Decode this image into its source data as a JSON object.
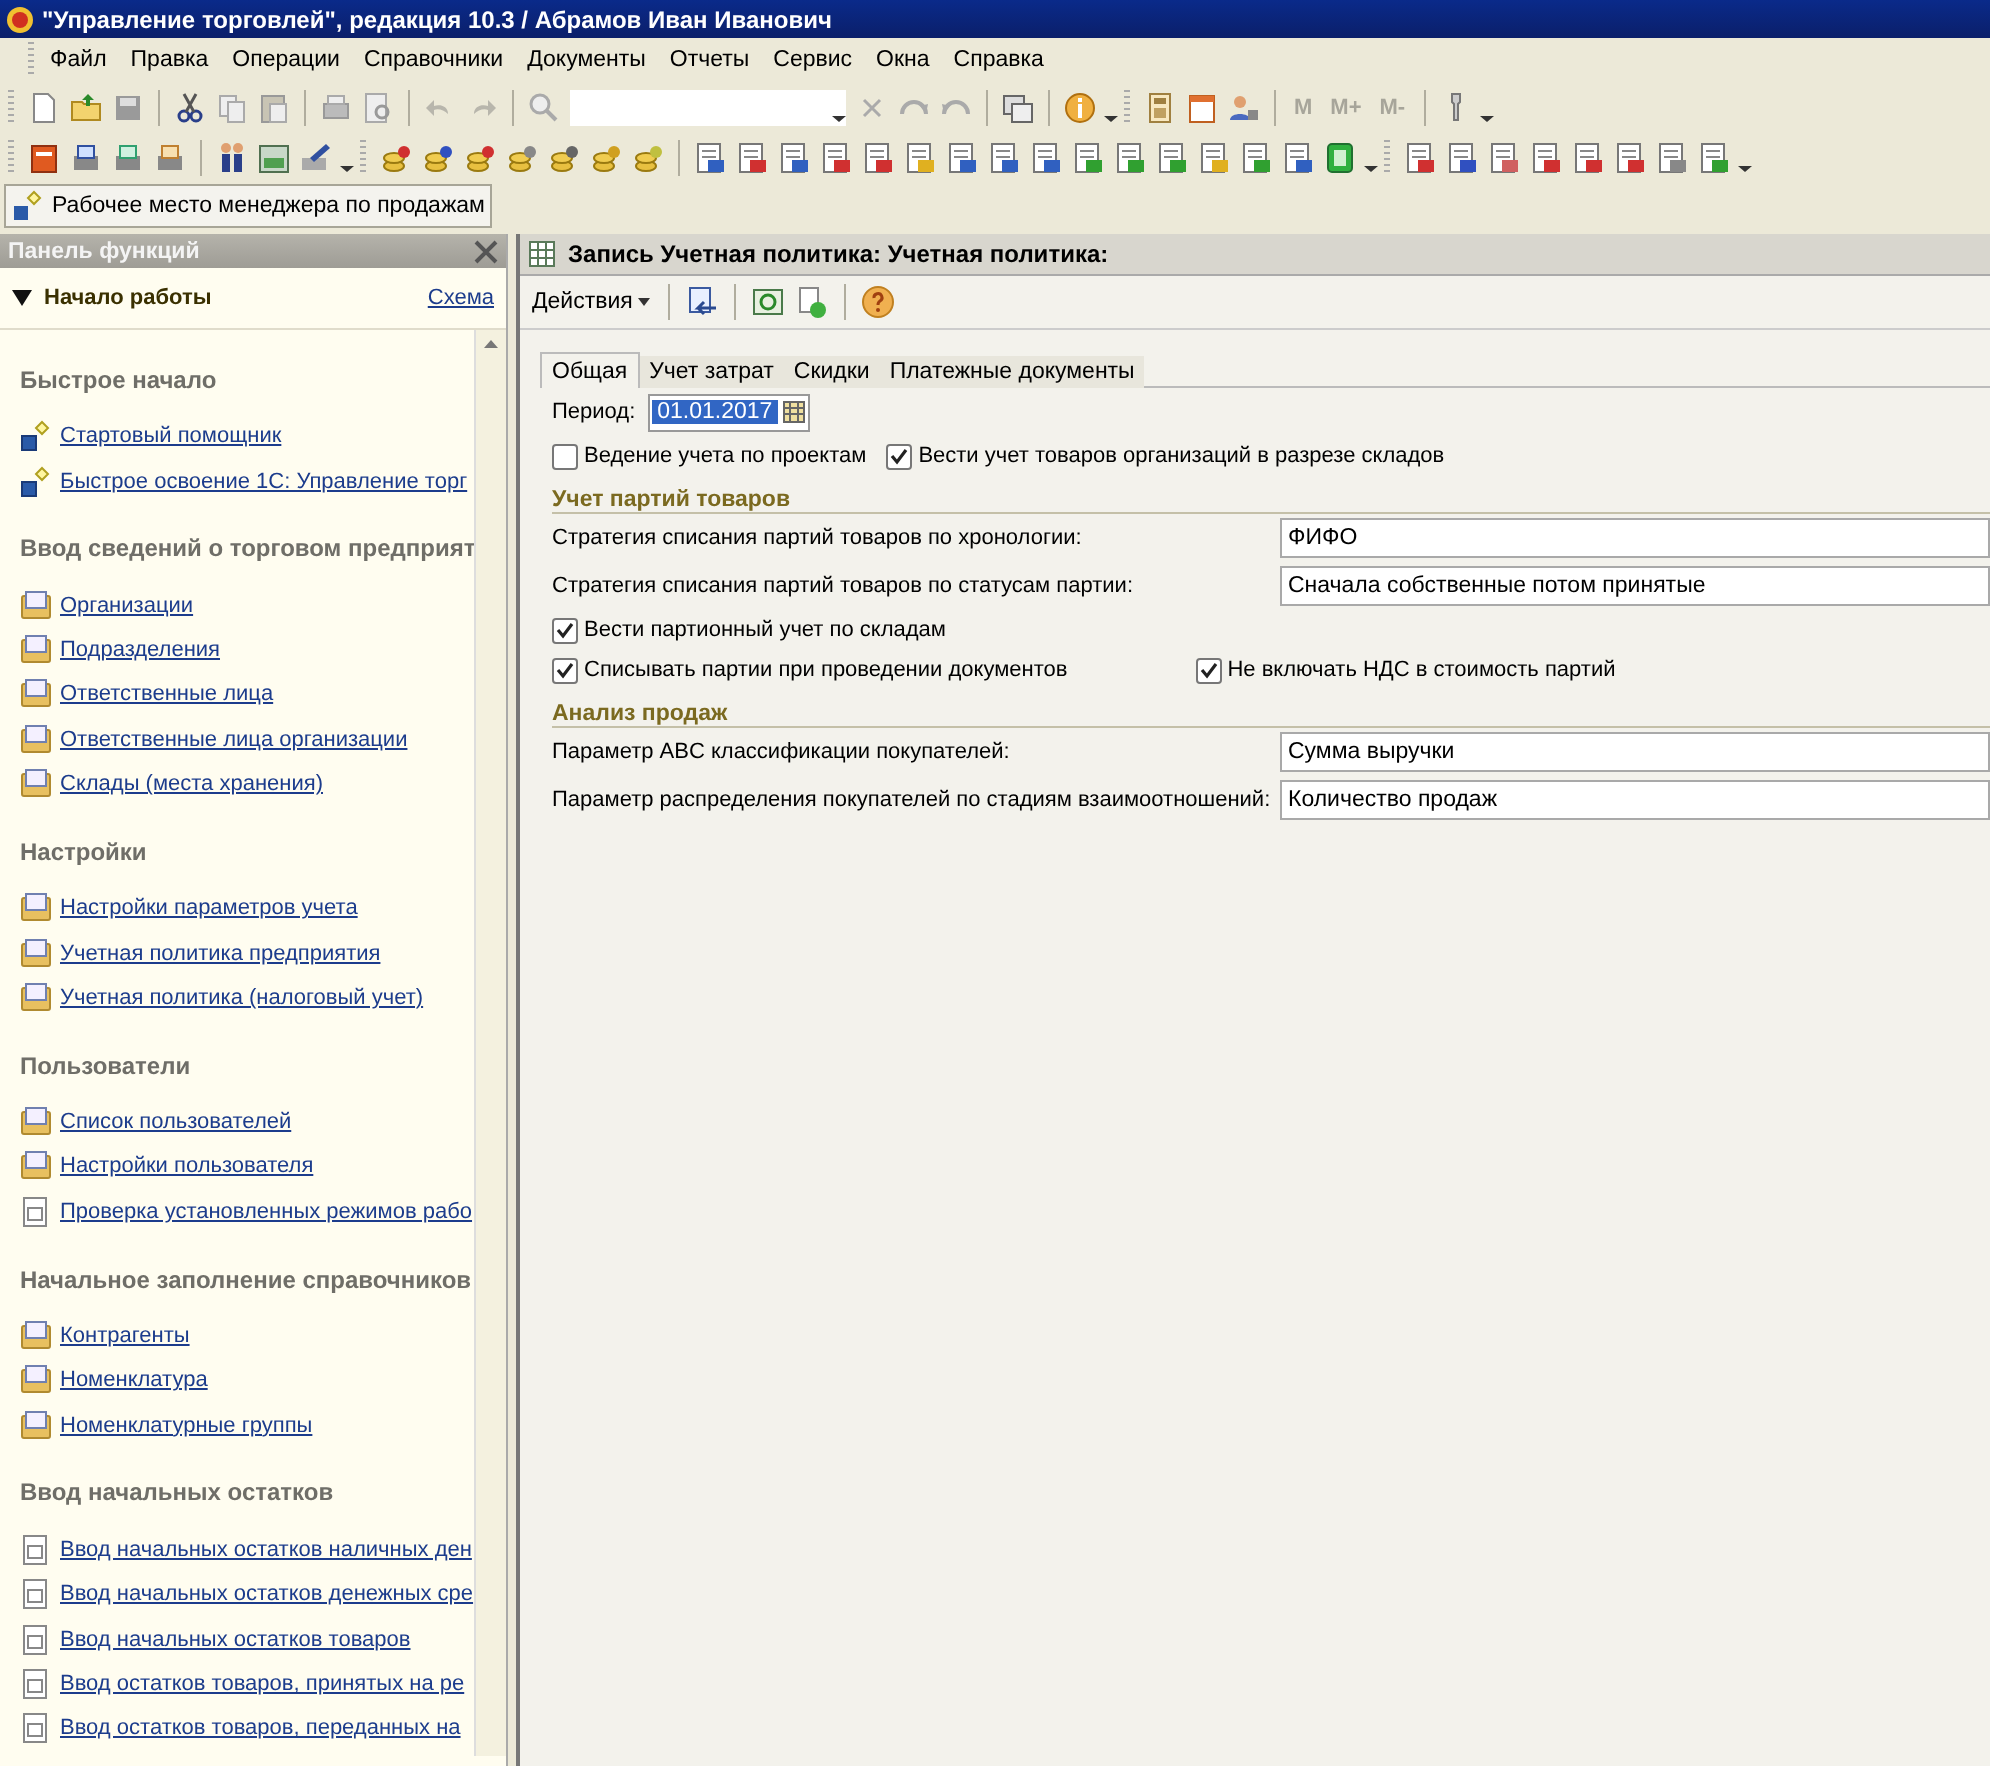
{
  "window": {
    "title": "\"Управление торговлей\", редакция 10.3 / Абрамов Иван Иванович"
  },
  "menu": [
    "Файл",
    "Правка",
    "Операции",
    "Справочники",
    "Документы",
    "Отчеты",
    "Сервис",
    "Окна",
    "Справка"
  ],
  "memory_buttons": [
    "M",
    "M+",
    "M-"
  ],
  "workspace_button": {
    "label": "Рабочее место менеджера по продажам"
  },
  "function_panel": {
    "title": "Панель функций",
    "section_title": "Начало работы",
    "scheme_link": "Схема",
    "groups": [
      {
        "title": "Быстрое начало",
        "items": [
          {
            "label": "Стартовый помощник",
            "kind": "wizard"
          },
          {
            "label": "Быстрое освоение 1С: Управление торг",
            "kind": "wizard"
          }
        ]
      },
      {
        "title": "Ввод сведений о торговом предприят",
        "items": [
          {
            "label": "Организации",
            "kind": "catalog"
          },
          {
            "label": "Подразделения",
            "kind": "catalog"
          },
          {
            "label": "Ответственные лица",
            "kind": "catalog"
          },
          {
            "label": "Ответственные лица организации",
            "kind": "catalog"
          },
          {
            "label": "Склады (места хранения)",
            "kind": "catalog"
          }
        ]
      },
      {
        "title": "Настройки",
        "items": [
          {
            "label": "Настройки параметров учета",
            "kind": "catalog"
          },
          {
            "label": "Учетная политика предприятия",
            "kind": "catalog"
          },
          {
            "label": "Учетная политика (налоговый учет)",
            "kind": "catalog"
          }
        ]
      },
      {
        "title": "Пользователи",
        "items": [
          {
            "label": "Список пользователей",
            "kind": "catalog"
          },
          {
            "label": "Настройки пользователя",
            "kind": "catalog"
          },
          {
            "label": "Проверка установленных режимов рабо",
            "kind": "document"
          }
        ]
      },
      {
        "title": "Начальное заполнение справочников",
        "items": [
          {
            "label": "Контрагенты",
            "kind": "catalog"
          },
          {
            "label": "Номенклатура",
            "kind": "catalog"
          },
          {
            "label": "Номенклатурные группы",
            "kind": "catalog"
          }
        ]
      },
      {
        "title": "Ввод начальных остатков",
        "items": [
          {
            "label": "Ввод начальных остатков наличных ден",
            "kind": "document"
          },
          {
            "label": "Ввод начальных остатков денежных сре",
            "kind": "document"
          },
          {
            "label": "Ввод начальных остатков товаров",
            "kind": "document"
          },
          {
            "label": "Ввод остатков товаров, принятых на ре",
            "kind": "document"
          },
          {
            "label": "Ввод остатков товаров, переданных на",
            "kind": "document"
          }
        ]
      }
    ]
  },
  "form": {
    "title": "Запись Учетная политика: Учетная политика:",
    "actions_label": "Действия",
    "tabs": [
      {
        "label": "Общая",
        "selected": true
      },
      {
        "label": "Учет затрат",
        "selected": false
      },
      {
        "label": "Скидки",
        "selected": false
      },
      {
        "label": "Платежные документы",
        "selected": false
      }
    ],
    "period": {
      "label": "Период:",
      "value": "01.01.2017"
    },
    "rows": [
      {
        "kind": "checks",
        "items": [
          {
            "label": "Ведение учета по проектам",
            "checked": false
          },
          {
            "label": "Вести учет товаров организаций в разрезе складов",
            "checked": true
          }
        ]
      },
      {
        "kind": "section",
        "label": "Учет партий товаров"
      },
      {
        "kind": "field",
        "label": "Стратегия списания партий товаров по хронологии:",
        "value": "ФИФО"
      },
      {
        "kind": "field",
        "label": "Стратегия списания партий товаров по статусам партии:",
        "value": "Сначала собственные потом принятые"
      },
      {
        "kind": "checks",
        "items": [
          {
            "label": "Вести партионный учет по складам",
            "checked": true
          }
        ]
      },
      {
        "kind": "checks",
        "items": [
          {
            "label": "Списывать партии при проведении документов",
            "checked": true
          },
          {
            "label": "Не включать НДС в стоимость партий",
            "checked": true
          }
        ]
      },
      {
        "kind": "section",
        "label": "Анализ продаж"
      },
      {
        "kind": "field",
        "label": "Параметр ABC классификации покупателей:",
        "value": "Сумма выручки"
      },
      {
        "kind": "field",
        "label": "Параметр распределения покупателей по стадиям взаимоотношений:",
        "value": "Количество продаж"
      }
    ]
  }
}
